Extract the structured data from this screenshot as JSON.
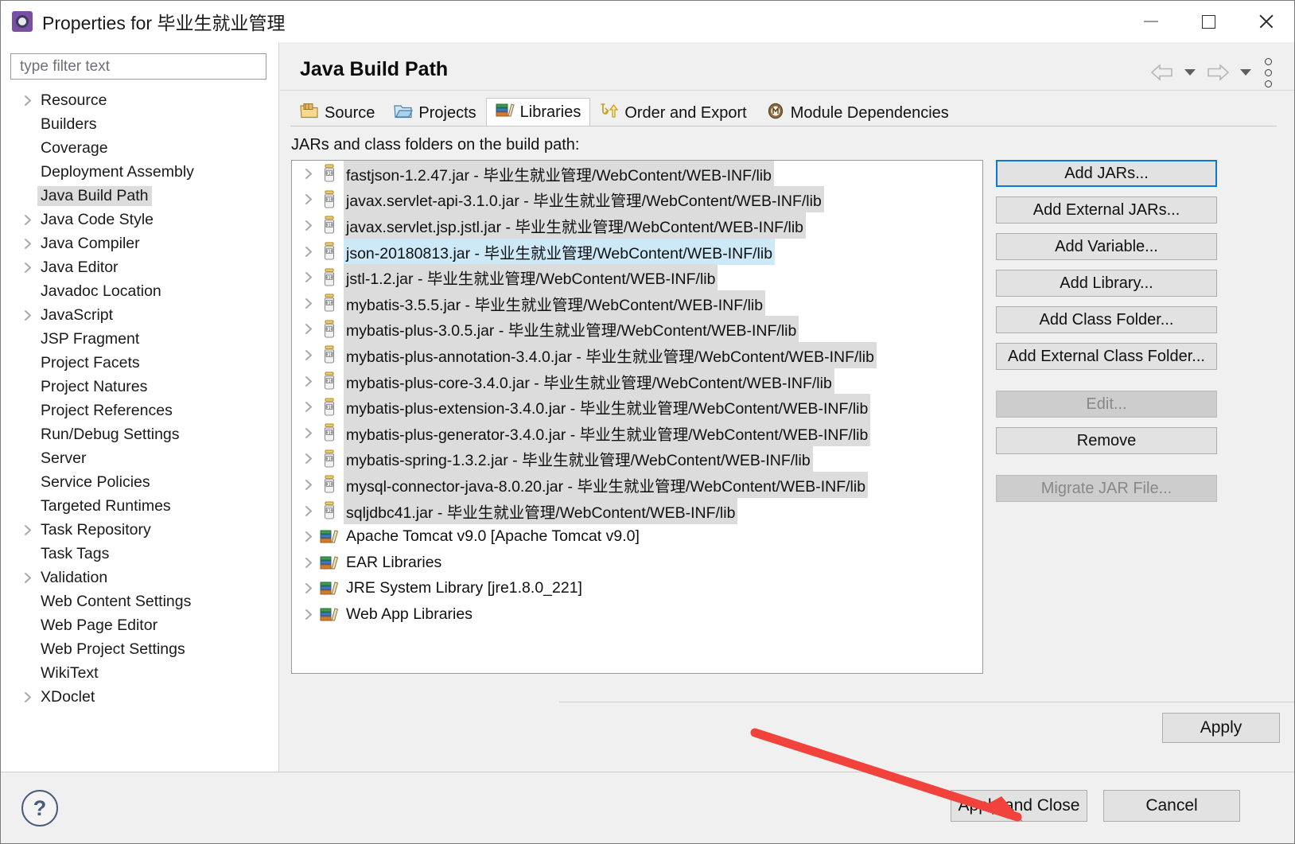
{
  "window": {
    "title": "Properties for 毕业生就业管理",
    "icon": "properties-gear-icon",
    "minimize": "−",
    "maximize": "□",
    "close": "✕"
  },
  "filter": {
    "placeholder": "type filter text",
    "value": ""
  },
  "sidebar": {
    "items": [
      {
        "label": "Resource",
        "expandable": true,
        "selected": false
      },
      {
        "label": "Builders",
        "expandable": false,
        "selected": false
      },
      {
        "label": "Coverage",
        "expandable": false,
        "selected": false
      },
      {
        "label": "Deployment Assembly",
        "expandable": false,
        "selected": false
      },
      {
        "label": "Java Build Path",
        "expandable": false,
        "selected": true
      },
      {
        "label": "Java Code Style",
        "expandable": true,
        "selected": false
      },
      {
        "label": "Java Compiler",
        "expandable": true,
        "selected": false
      },
      {
        "label": "Java Editor",
        "expandable": true,
        "selected": false
      },
      {
        "label": "Javadoc Location",
        "expandable": false,
        "selected": false
      },
      {
        "label": "JavaScript",
        "expandable": true,
        "selected": false
      },
      {
        "label": "JSP Fragment",
        "expandable": false,
        "selected": false
      },
      {
        "label": "Project Facets",
        "expandable": false,
        "selected": false
      },
      {
        "label": "Project Natures",
        "expandable": false,
        "selected": false
      },
      {
        "label": "Project References",
        "expandable": false,
        "selected": false
      },
      {
        "label": "Run/Debug Settings",
        "expandable": false,
        "selected": false
      },
      {
        "label": "Server",
        "expandable": false,
        "selected": false
      },
      {
        "label": "Service Policies",
        "expandable": false,
        "selected": false
      },
      {
        "label": "Targeted Runtimes",
        "expandable": false,
        "selected": false
      },
      {
        "label": "Task Repository",
        "expandable": true,
        "selected": false
      },
      {
        "label": "Task Tags",
        "expandable": false,
        "selected": false
      },
      {
        "label": "Validation",
        "expandable": true,
        "selected": false
      },
      {
        "label": "Web Content Settings",
        "expandable": false,
        "selected": false
      },
      {
        "label": "Web Page Editor",
        "expandable": false,
        "selected": false
      },
      {
        "label": "Web Project Settings",
        "expandable": false,
        "selected": false
      },
      {
        "label": "WikiText",
        "expandable": false,
        "selected": false
      },
      {
        "label": "XDoclet",
        "expandable": true,
        "selected": false
      }
    ]
  },
  "page": {
    "title": "Java Build Path",
    "nav": {
      "back_icon": "back-arrow-icon",
      "back_menu_icon": "chevron-down-icon",
      "forward_icon": "forward-arrow-icon",
      "forward_menu_icon": "chevron-down-icon",
      "menu_icon": "vertical-dots-icon"
    },
    "tabs": [
      {
        "label": "Source",
        "icon": "source-folder-icon",
        "active": false
      },
      {
        "label": "Projects",
        "icon": "projects-folder-icon",
        "active": false
      },
      {
        "label": "Libraries",
        "icon": "libraries-books-icon",
        "active": true
      },
      {
        "label": "Order and Export",
        "icon": "order-export-arrows-icon",
        "active": false
      },
      {
        "label": "Module Dependencies",
        "icon": "module-circle-icon",
        "active": false
      }
    ],
    "subheading": "JARs and class folders on the build path:"
  },
  "library_list": [
    {
      "text": "fastjson-1.2.47.jar - 毕业生就业管理/WebContent/WEB-INF/lib",
      "type": "jar",
      "state": "highlighted"
    },
    {
      "text": "javax.servlet-api-3.1.0.jar - 毕业生就业管理/WebContent/WEB-INF/lib",
      "type": "jar",
      "state": "highlighted"
    },
    {
      "text": "javax.servlet.jsp.jstl.jar - 毕业生就业管理/WebContent/WEB-INF/lib",
      "type": "jar",
      "state": "highlighted"
    },
    {
      "text": "json-20180813.jar - 毕业生就业管理/WebContent/WEB-INF/lib",
      "type": "jar",
      "state": "selected"
    },
    {
      "text": "jstl-1.2.jar - 毕业生就业管理/WebContent/WEB-INF/lib",
      "type": "jar",
      "state": "highlighted"
    },
    {
      "text": "mybatis-3.5.5.jar - 毕业生就业管理/WebContent/WEB-INF/lib",
      "type": "jar",
      "state": "highlighted"
    },
    {
      "text": "mybatis-plus-3.0.5.jar - 毕业生就业管理/WebContent/WEB-INF/lib",
      "type": "jar",
      "state": "highlighted"
    },
    {
      "text": "mybatis-plus-annotation-3.4.0.jar - 毕业生就业管理/WebContent/WEB-INF/lib",
      "type": "jar",
      "state": "highlighted"
    },
    {
      "text": "mybatis-plus-core-3.4.0.jar - 毕业生就业管理/WebContent/WEB-INF/lib",
      "type": "jar",
      "state": "highlighted"
    },
    {
      "text": "mybatis-plus-extension-3.4.0.jar - 毕业生就业管理/WebContent/WEB-INF/lib",
      "type": "jar",
      "state": "highlighted"
    },
    {
      "text": "mybatis-plus-generator-3.4.0.jar - 毕业生就业管理/WebContent/WEB-INF/lib",
      "type": "jar",
      "state": "highlighted"
    },
    {
      "text": "mybatis-spring-1.3.2.jar - 毕业生就业管理/WebContent/WEB-INF/lib",
      "type": "jar",
      "state": "highlighted"
    },
    {
      "text": "mysql-connector-java-8.0.20.jar - 毕业生就业管理/WebContent/WEB-INF/lib",
      "type": "jar",
      "state": "highlighted"
    },
    {
      "text": "sqljdbc41.jar - 毕业生就业管理/WebContent/WEB-INF/lib",
      "type": "jar",
      "state": "highlighted"
    },
    {
      "text": "Apache Tomcat v9.0 [Apache Tomcat v9.0]",
      "type": "library",
      "state": "normal"
    },
    {
      "text": "EAR Libraries",
      "type": "library",
      "state": "normal"
    },
    {
      "text": "JRE System Library [jre1.8.0_221]",
      "type": "library",
      "state": "normal"
    },
    {
      "text": "Web App Libraries",
      "type": "library",
      "state": "normal"
    }
  ],
  "side_buttons": [
    {
      "label": "Add JARs...",
      "state": "default-focused"
    },
    {
      "label": "Add External JARs...",
      "state": "enabled"
    },
    {
      "label": "Add Variable...",
      "state": "enabled"
    },
    {
      "label": "Add Library...",
      "state": "enabled"
    },
    {
      "label": "Add Class Folder...",
      "state": "enabled"
    },
    {
      "label": "Add External Class Folder...",
      "state": "enabled"
    },
    {
      "label": "Edit...",
      "state": "disabled"
    },
    {
      "label": "Remove",
      "state": "enabled"
    },
    {
      "label": "Migrate JAR File...",
      "state": "disabled"
    }
  ],
  "footer": {
    "help_icon": "help-question-icon",
    "apply": "Apply",
    "apply_and_close": "Apply and Close",
    "cancel": "Cancel"
  },
  "annotation": {
    "type": "red-arrow",
    "color": "#f2423c",
    "points_to": "Apply and Close"
  }
}
